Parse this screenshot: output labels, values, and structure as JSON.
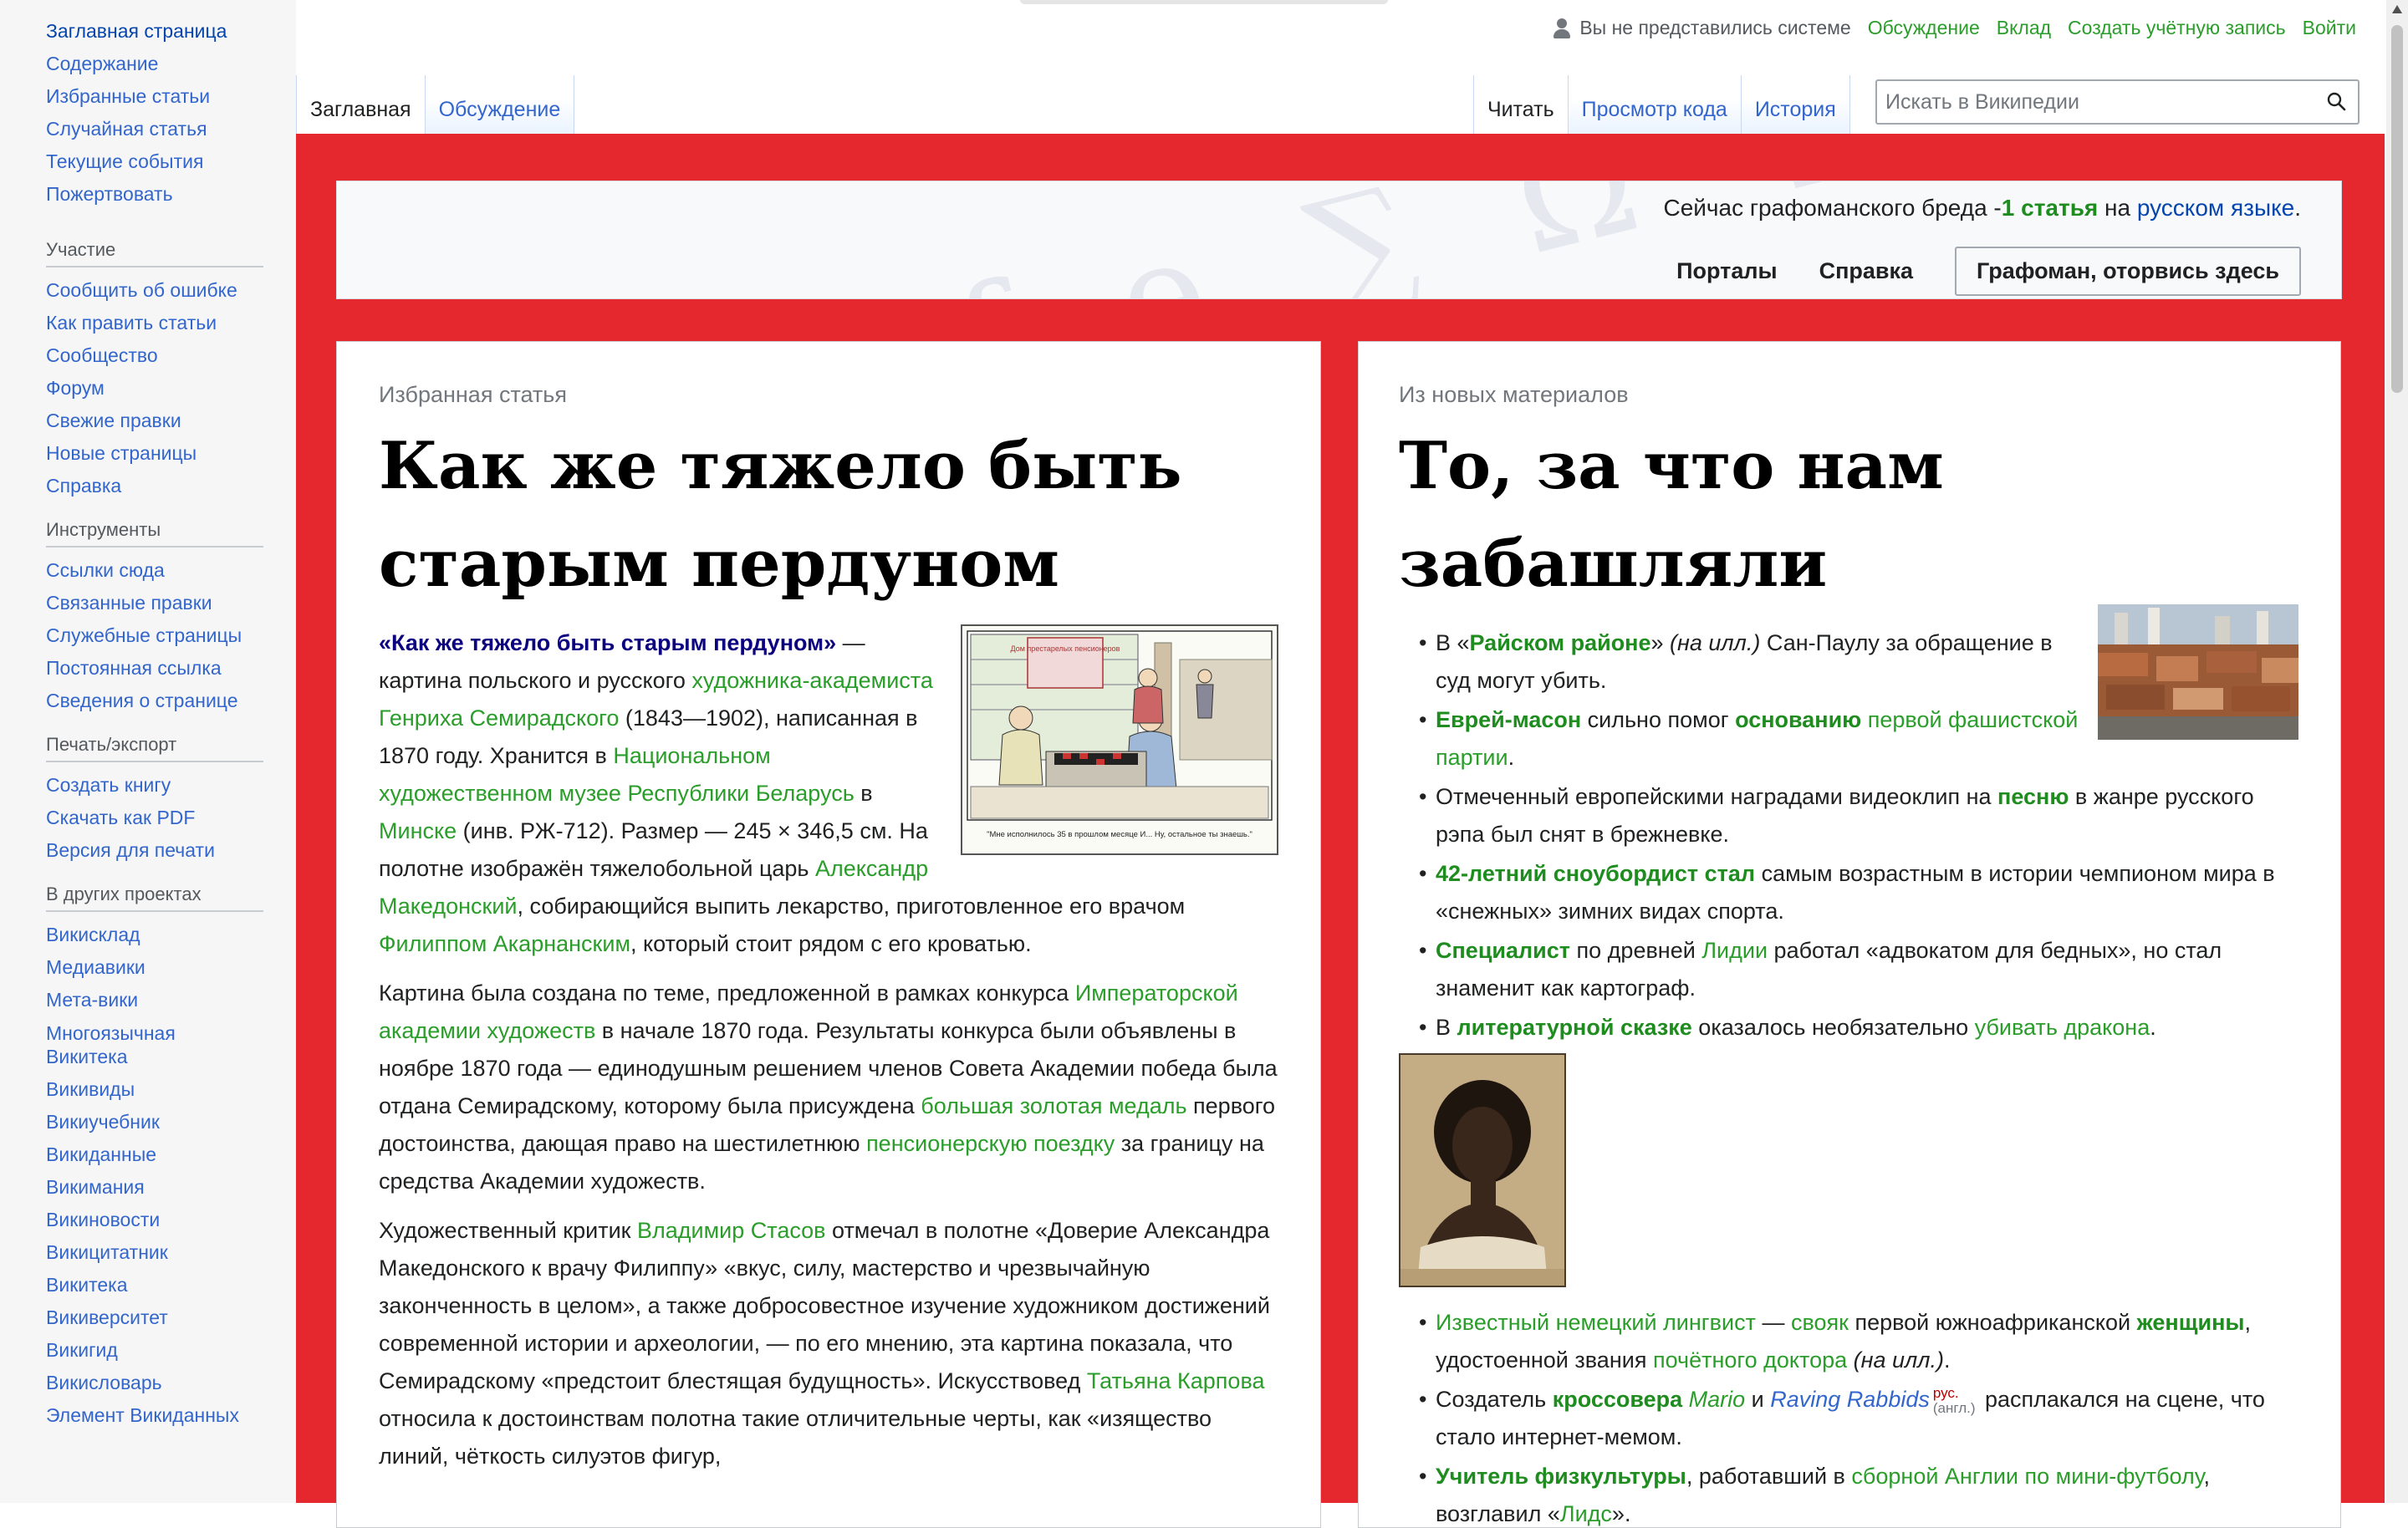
{
  "sidebar": {
    "nav": [
      "Заглавная страница",
      "Содержание",
      "Избранные статьи",
      "Случайная статья",
      "Текущие события",
      "Пожертвовать"
    ],
    "participation": {
      "heading": "Участие",
      "items": [
        "Сообщить об ошибке",
        "Как править статьи",
        "Сообщество",
        "Форум",
        "Свежие правки",
        "Новые страницы",
        "Справка"
      ]
    },
    "tools": {
      "heading": "Инструменты",
      "items": [
        "Ссылки сюда",
        "Связанные правки",
        "Служебные страницы",
        "Постоянная ссылка",
        "Сведения о странице"
      ]
    },
    "print": {
      "heading": "Печать/экспорт",
      "items": [
        "Создать книгу",
        "Скачать как PDF",
        "Версия для печати"
      ]
    },
    "projects": {
      "heading": "В других проектах",
      "items": [
        "Викисклад",
        "Медиавики",
        "Мета-вики",
        "Многоязычная Викитека",
        "Викивиды",
        "Викиучебник",
        "Викиданные",
        "Викимания",
        "Викиновости",
        "Викицитатник",
        "Викитека",
        "Викиверситет",
        "Викигид",
        "Викисловарь",
        "Элемент Викиданных"
      ]
    }
  },
  "personal": {
    "not_logged_in": "Вы не представились системе",
    "talk": "Обсуждение",
    "contributions": "Вклад",
    "create_account": "Создать учётную запись",
    "login": "Войти"
  },
  "tabs": {
    "main": "Заглавная",
    "talk": "Обсуждение",
    "read": "Читать",
    "view_source": "Просмотр кода",
    "history": "История"
  },
  "search": {
    "placeholder": "Искать в Википедии"
  },
  "portal": {
    "status_prefix": "Сейчас  графоманского бреда -",
    "status_count": "1 статья",
    "status_on": " на ",
    "status_lang": "русском языке",
    "status_end": ".",
    "portals": "Порталы",
    "help": "Справка",
    "cta": "Графоман, оторвись здесь",
    "deco": "ΩΨ ξ ƒ ɘ ∑ Ω Ψ Ж Ə"
  },
  "featured": {
    "label": "Избранная статья",
    "title": "Как же тяжело быть старым пердуном",
    "picture_caption": "\"Мне исполнилось 35 в прошлом месяце И... Ну, остальное ты знаешь.\"",
    "picture_sign": "Дом престарелых пенсионеров",
    "p1": {
      "bold": "«Как же тяжело быть старым пердуном»",
      "t1": " — картина польского и русского ",
      "l1": "художника-академиста Генриха Семирадского",
      "t2": " (1843—1902), написанная в 1870 году. Хранится в ",
      "l2": "Национальном художественном музее Республики Беларусь",
      "t3": " в ",
      "l3": "Минске",
      "t4": " (инв. РЖ-712). Размер — 245 × 346,5 см. На полотне изображён тяжелобольной царь ",
      "l4": "Александр Македонский",
      "t5": ", собирающийся выпить лекарство, приготовленное его врачом ",
      "l5": "Филиппом Акарнанским",
      "t6": ", который стоит рядом с его кроватью."
    },
    "p2": {
      "t1": "Картина была создана по теме, предложенной в рамках конкурса ",
      "l1": "Императорской академии художеств",
      "t2": " в начале 1870 года. Результаты конкурса были объявлены в ноябре 1870 года — единодушным решением членов Совета Академии победа была отдана Семирадскому, которому была присуждена ",
      "l2": "большая золотая медаль",
      "t3": " первого достоинства, дающая право на шестилетнюю ",
      "l3": "пенсионерскую поездку",
      "t4": " за границу на средства Академии художеств."
    },
    "p3": {
      "t1": "Художественный критик ",
      "l1": "Владимир Стасов",
      "t2": " отмечал в полотне «Доверие Александра Македонского к врачу Филиппу» «вкус, силу, мастерство и чрезвычайную законченность в целом», а также добросовестное изучение художником достижений современной истории и археологии, — по его мнению, эта картина показала, что Семирадскому «предстоит блестящая будущность». Искусствовед ",
      "l2": "Татьяна Карпова",
      "t3": " относила к достоинствам полотна такие отличительные черты, как «изящество линий, чёткость силуэтов фигур,"
    }
  },
  "news": {
    "label": "Из новых материалов",
    "title": "То, за что нам забашляли",
    "items": [
      {
        "t1": "В «",
        "l1": "Райском районе",
        "t2": "» ",
        "i1": "(на илл.)",
        "t3": " Сан-Паулу за обращение в суд могут убить."
      },
      {
        "l1": "Еврей-масон",
        "t1": " сильно помог ",
        "l2": "основанию",
        "t2": " ",
        "l3": "первой фашистской партии",
        "t3": "."
      },
      {
        "t1": "Отмеченный европейскими наградами видеоклип на ",
        "l1": "песню",
        "t2": " в жанре русского рэпа был снят в брежневке."
      },
      {
        "l1": "42-летний сноубордист стал",
        "t1": " самым возрастным в истории чемпионом мира в «снежных» зимних видах спорта."
      },
      {
        "l1": "Специалист",
        "t1": " по древней ",
        "l2": "Лидии",
        "t2": " работал «адвокатом для бедных», но стал знаменит как картограф."
      },
      {
        "t1": "В ",
        "l1": "литературной сказке",
        "t2": " оказалось необязательно ",
        "l2": "убивать дракона",
        "t3": "."
      },
      {
        "l1": "Известный немецкий лингвист",
        "t1": " — ",
        "l2": "свояк",
        "t2": " первой южноафриканской ",
        "l3": "женщины",
        "t3": ", удостоенной звания ",
        "l4": "почётного доктора",
        "t4": " ",
        "i1": "(на илл.)",
        "t5": "."
      },
      {
        "t1": "Создатель ",
        "l1": "кроссовера",
        "t2": " ",
        "l2": "Mario",
        "t3": " и ",
        "l3": "Raving Rabbids",
        "s1": "рус.",
        "s2": "(англ.)",
        "t4": " расплакался на сцене, что стало интернет-мемом."
      },
      {
        "l1": "Учитель физкультуры",
        "t1": ", работавший в ",
        "l2": "сборной Англии по мини-футболу",
        "t2": ", возглавил «",
        "l3": "Лидс",
        "t3": "»."
      }
    ]
  },
  "colors": {
    "frame_red": "#e5282e",
    "link_blue": "#3366cc",
    "link_green": "#2a9d2a",
    "sidebar_bg": "#f6f6f6"
  },
  "icons": [
    "user-icon",
    "search-icon"
  ]
}
